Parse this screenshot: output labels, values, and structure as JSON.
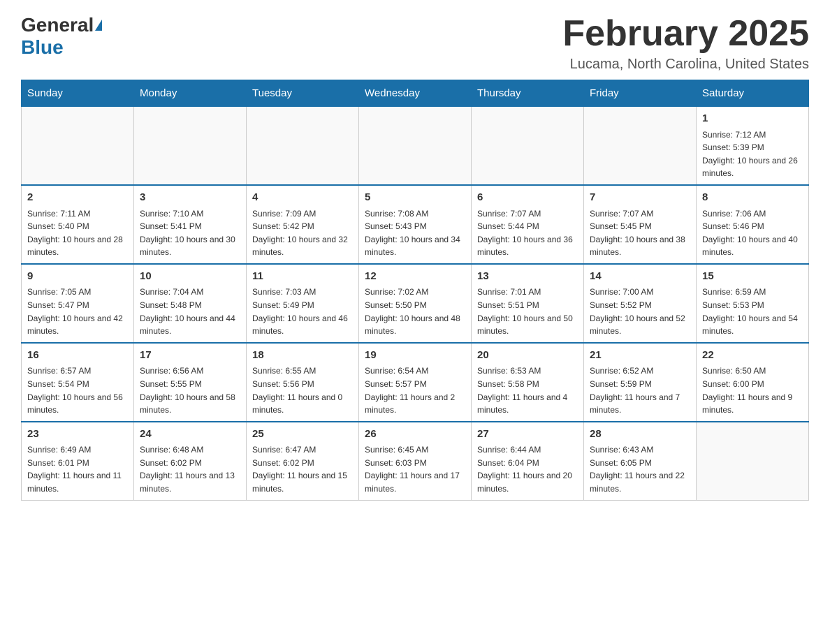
{
  "logo": {
    "general": "General",
    "blue": "Blue"
  },
  "title": "February 2025",
  "location": "Lucama, North Carolina, United States",
  "weekdays": [
    "Sunday",
    "Monday",
    "Tuesday",
    "Wednesday",
    "Thursday",
    "Friday",
    "Saturday"
  ],
  "weeks": [
    [
      {
        "day": "",
        "info": ""
      },
      {
        "day": "",
        "info": ""
      },
      {
        "day": "",
        "info": ""
      },
      {
        "day": "",
        "info": ""
      },
      {
        "day": "",
        "info": ""
      },
      {
        "day": "",
        "info": ""
      },
      {
        "day": "1",
        "info": "Sunrise: 7:12 AM\nSunset: 5:39 PM\nDaylight: 10 hours and 26 minutes."
      }
    ],
    [
      {
        "day": "2",
        "info": "Sunrise: 7:11 AM\nSunset: 5:40 PM\nDaylight: 10 hours and 28 minutes."
      },
      {
        "day": "3",
        "info": "Sunrise: 7:10 AM\nSunset: 5:41 PM\nDaylight: 10 hours and 30 minutes."
      },
      {
        "day": "4",
        "info": "Sunrise: 7:09 AM\nSunset: 5:42 PM\nDaylight: 10 hours and 32 minutes."
      },
      {
        "day": "5",
        "info": "Sunrise: 7:08 AM\nSunset: 5:43 PM\nDaylight: 10 hours and 34 minutes."
      },
      {
        "day": "6",
        "info": "Sunrise: 7:07 AM\nSunset: 5:44 PM\nDaylight: 10 hours and 36 minutes."
      },
      {
        "day": "7",
        "info": "Sunrise: 7:07 AM\nSunset: 5:45 PM\nDaylight: 10 hours and 38 minutes."
      },
      {
        "day": "8",
        "info": "Sunrise: 7:06 AM\nSunset: 5:46 PM\nDaylight: 10 hours and 40 minutes."
      }
    ],
    [
      {
        "day": "9",
        "info": "Sunrise: 7:05 AM\nSunset: 5:47 PM\nDaylight: 10 hours and 42 minutes."
      },
      {
        "day": "10",
        "info": "Sunrise: 7:04 AM\nSunset: 5:48 PM\nDaylight: 10 hours and 44 minutes."
      },
      {
        "day": "11",
        "info": "Sunrise: 7:03 AM\nSunset: 5:49 PM\nDaylight: 10 hours and 46 minutes."
      },
      {
        "day": "12",
        "info": "Sunrise: 7:02 AM\nSunset: 5:50 PM\nDaylight: 10 hours and 48 minutes."
      },
      {
        "day": "13",
        "info": "Sunrise: 7:01 AM\nSunset: 5:51 PM\nDaylight: 10 hours and 50 minutes."
      },
      {
        "day": "14",
        "info": "Sunrise: 7:00 AM\nSunset: 5:52 PM\nDaylight: 10 hours and 52 minutes."
      },
      {
        "day": "15",
        "info": "Sunrise: 6:59 AM\nSunset: 5:53 PM\nDaylight: 10 hours and 54 minutes."
      }
    ],
    [
      {
        "day": "16",
        "info": "Sunrise: 6:57 AM\nSunset: 5:54 PM\nDaylight: 10 hours and 56 minutes."
      },
      {
        "day": "17",
        "info": "Sunrise: 6:56 AM\nSunset: 5:55 PM\nDaylight: 10 hours and 58 minutes."
      },
      {
        "day": "18",
        "info": "Sunrise: 6:55 AM\nSunset: 5:56 PM\nDaylight: 11 hours and 0 minutes."
      },
      {
        "day": "19",
        "info": "Sunrise: 6:54 AM\nSunset: 5:57 PM\nDaylight: 11 hours and 2 minutes."
      },
      {
        "day": "20",
        "info": "Sunrise: 6:53 AM\nSunset: 5:58 PM\nDaylight: 11 hours and 4 minutes."
      },
      {
        "day": "21",
        "info": "Sunrise: 6:52 AM\nSunset: 5:59 PM\nDaylight: 11 hours and 7 minutes."
      },
      {
        "day": "22",
        "info": "Sunrise: 6:50 AM\nSunset: 6:00 PM\nDaylight: 11 hours and 9 minutes."
      }
    ],
    [
      {
        "day": "23",
        "info": "Sunrise: 6:49 AM\nSunset: 6:01 PM\nDaylight: 11 hours and 11 minutes."
      },
      {
        "day": "24",
        "info": "Sunrise: 6:48 AM\nSunset: 6:02 PM\nDaylight: 11 hours and 13 minutes."
      },
      {
        "day": "25",
        "info": "Sunrise: 6:47 AM\nSunset: 6:02 PM\nDaylight: 11 hours and 15 minutes."
      },
      {
        "day": "26",
        "info": "Sunrise: 6:45 AM\nSunset: 6:03 PM\nDaylight: 11 hours and 17 minutes."
      },
      {
        "day": "27",
        "info": "Sunrise: 6:44 AM\nSunset: 6:04 PM\nDaylight: 11 hours and 20 minutes."
      },
      {
        "day": "28",
        "info": "Sunrise: 6:43 AM\nSunset: 6:05 PM\nDaylight: 11 hours and 22 minutes."
      },
      {
        "day": "",
        "info": ""
      }
    ]
  ]
}
